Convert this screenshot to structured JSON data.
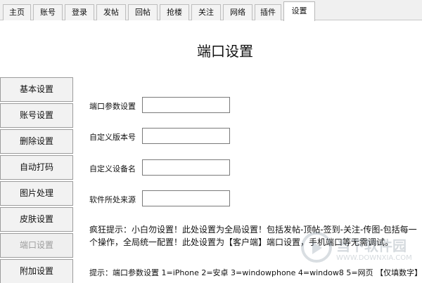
{
  "tabs": [
    {
      "label": "主页"
    },
    {
      "label": "账号"
    },
    {
      "label": "登录"
    },
    {
      "label": "发帖"
    },
    {
      "label": "回帖"
    },
    {
      "label": "抢楼"
    },
    {
      "label": "关注"
    },
    {
      "label": "网络"
    },
    {
      "label": "插件"
    },
    {
      "label": "设置",
      "active": true
    }
  ],
  "page_title": "端口设置",
  "sidebar": {
    "items": [
      {
        "label": "基本设置"
      },
      {
        "label": "账号设置"
      },
      {
        "label": "删除设置"
      },
      {
        "label": "自动打码"
      },
      {
        "label": "图片处理"
      },
      {
        "label": "皮肤设置"
      },
      {
        "label": "端口设置",
        "disabled": true
      },
      {
        "label": "附加设置"
      }
    ]
  },
  "form": {
    "port_param": {
      "label": "端口参数设置",
      "value": ""
    },
    "custom_version": {
      "label": "自定义版本号",
      "value": ""
    },
    "custom_device": {
      "label": "自定义设备名",
      "value": ""
    },
    "software_source": {
      "label": "软件所处来源",
      "value": ""
    }
  },
  "tip_text": "疯狂提示：小白勿设置！此处设置为全局设置！包括发帖-顶帖-签到-关注-传图-包括每一个操作，全局统一配置！此处设置为【客户端】端口设置，手机端口等无需调试。",
  "hint_text": "提示：端口参数设置 1=iPhone 2=安卓 3=windowphone 4=window8 5=网页 【仅填数字】",
  "watermark": {
    "title": "当下软件园",
    "subtitle": "WWW.DOWNXIA.COM"
  }
}
